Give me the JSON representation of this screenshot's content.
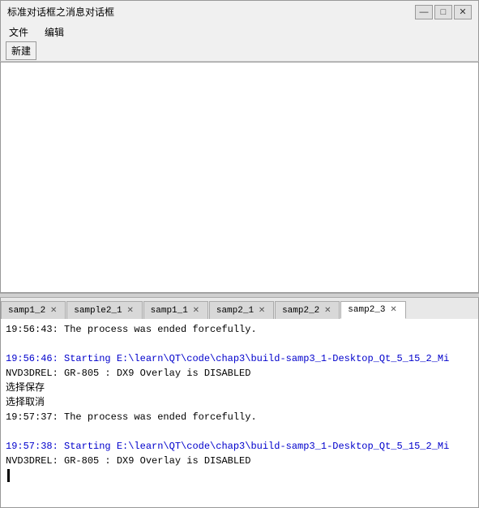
{
  "window": {
    "title": "标准对话框之消息对话框",
    "controls": {
      "minimize": "—",
      "maximize": "□",
      "close": "✕"
    }
  },
  "menubar": {
    "items": [
      "文件",
      "编辑"
    ]
  },
  "toolbar": {
    "new_label": "新建"
  },
  "tabs": [
    {
      "label": "samp1_2",
      "active": false
    },
    {
      "label": "sample2_1",
      "active": false
    },
    {
      "label": "samp1_1",
      "active": false
    },
    {
      "label": "samp2_1",
      "active": false
    },
    {
      "label": "samp2_2",
      "active": false
    },
    {
      "label": "samp2_3",
      "active": true
    }
  ],
  "console": {
    "lines": [
      {
        "text": "19:56:43: The process was ended forcefully.",
        "class": "normal"
      },
      {
        "text": "",
        "class": "normal"
      },
      {
        "text": "19:56:46: Starting E:\\learn\\QT\\code\\chap3\\build-samp3_1-Desktop_Qt_5_15_2_Mi",
        "class": "blue"
      },
      {
        "text": "NVD3DREL: GR-805 : DX9 Overlay is DISABLED",
        "class": "normal"
      },
      {
        "text": "选择保存",
        "class": "normal"
      },
      {
        "text": "选择取消",
        "class": "normal"
      },
      {
        "text": "19:57:37: The process was ended forcefully.",
        "class": "normal"
      },
      {
        "text": "",
        "class": "normal"
      },
      {
        "text": "19:57:38: Starting E:\\learn\\QT\\code\\chap3\\build-samp3_1-Desktop_Qt_5_15_2_Mi",
        "class": "blue"
      },
      {
        "text": "NVD3DREL: GR-805 : DX9 Overlay is DISABLED",
        "class": "normal"
      }
    ]
  }
}
